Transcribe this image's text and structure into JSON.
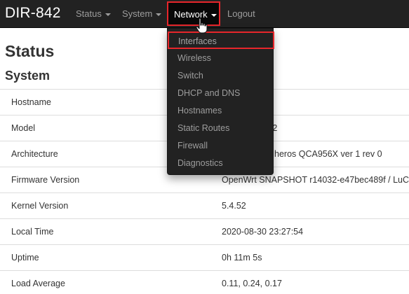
{
  "navbar": {
    "brand": "DIR-842",
    "items": [
      {
        "label": "Status"
      },
      {
        "label": "System"
      },
      {
        "label": "Network"
      },
      {
        "label": "Logout"
      }
    ]
  },
  "dropdown": {
    "items": [
      {
        "label": "Interfaces"
      },
      {
        "label": "Wireless"
      },
      {
        "label": "Switch"
      },
      {
        "label": "DHCP and DNS"
      },
      {
        "label": "Hostnames"
      },
      {
        "label": "Static Routes"
      },
      {
        "label": "Firewall"
      },
      {
        "label": "Diagnostics"
      }
    ]
  },
  "page": {
    "title": "Status",
    "section": "System"
  },
  "system": {
    "rows": [
      {
        "label": "Hostname",
        "value": ""
      },
      {
        "label": "Model",
        "value": "42 C2"
      },
      {
        "label": "Architecture",
        "value": "heros QCA956X ver 1 rev 0"
      },
      {
        "label": "Firmware Version",
        "value": "OpenWrt SNAPSHOT r14032-e47bec489f / LuC"
      },
      {
        "label": "Kernel Version",
        "value": "5.4.52"
      },
      {
        "label": "Local Time",
        "value": "2020-08-30 23:27:54"
      },
      {
        "label": "Uptime",
        "value": "0h 11m 5s"
      },
      {
        "label": "Load Average",
        "value": "0.11, 0.24, 0.17"
      }
    ]
  },
  "colors": {
    "navbar_bg": "#222222",
    "highlight_border": "#e8262b",
    "menu_text": "#9d9d9d"
  }
}
